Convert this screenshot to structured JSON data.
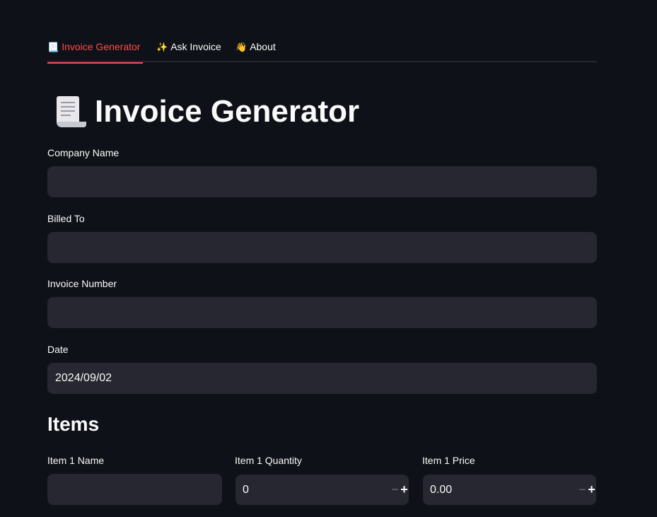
{
  "tabs": [
    {
      "label": "Invoice Generator",
      "icon": "scroll-icon",
      "glyph": "📃",
      "active": true
    },
    {
      "label": "Ask Invoice",
      "icon": "sparkles-icon",
      "glyph": "✨",
      "active": false
    },
    {
      "label": "About",
      "icon": "waving-hand-icon",
      "glyph": "👋",
      "active": false
    }
  ],
  "page": {
    "title": "Invoice Generator",
    "title_icon": "scroll-icon"
  },
  "fields": {
    "company_name": {
      "label": "Company Name",
      "value": ""
    },
    "billed_to": {
      "label": "Billed To",
      "value": ""
    },
    "invoice_number": {
      "label": "Invoice Number",
      "value": ""
    },
    "date": {
      "label": "Date",
      "value": "2024/09/02"
    }
  },
  "items": {
    "section_title": "Items",
    "item1_name": {
      "label": "Item 1 Name",
      "value": ""
    },
    "item1_quantity": {
      "label": "Item 1 Quantity",
      "value": "0"
    },
    "item1_price": {
      "label": "Item 1 Price",
      "value": "0.00"
    },
    "minus_glyph": "−",
    "plus_glyph": "+"
  },
  "colors": {
    "background": "#0e1117",
    "input_bg": "#262730",
    "accent": "#ff4b4b",
    "text": "#fafafa"
  }
}
